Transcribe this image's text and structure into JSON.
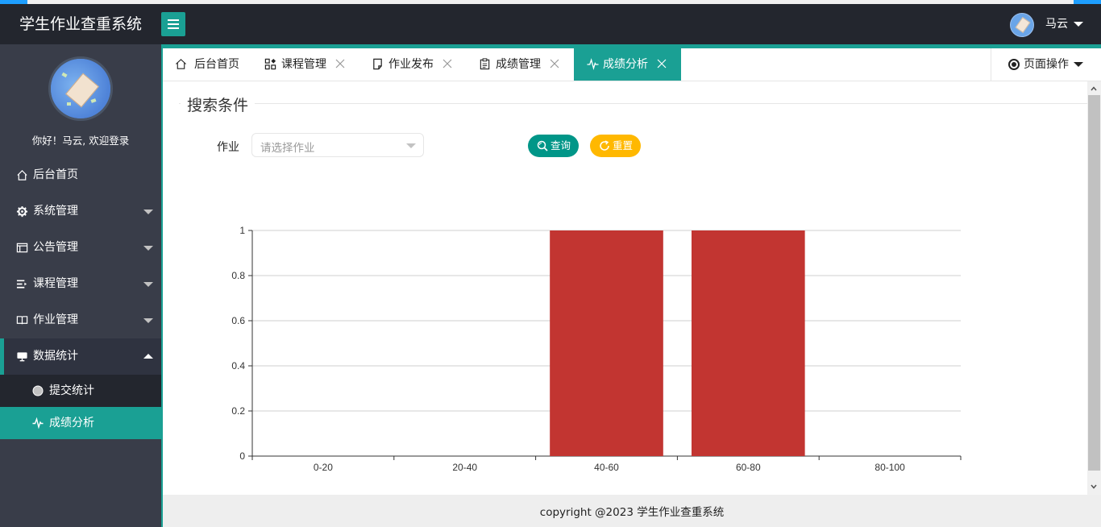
{
  "app": {
    "title": "学生作业查重系统",
    "user_name": "马云",
    "welcome": "你好！马云, 欢迎登录"
  },
  "sidebar": {
    "items": [
      {
        "label": "后台首页",
        "icon": "home-icon"
      },
      {
        "label": "系统管理",
        "icon": "gear-icon"
      },
      {
        "label": "公告管理",
        "icon": "layout-icon"
      },
      {
        "label": "课程管理",
        "icon": "list-icon"
      },
      {
        "label": "作业管理",
        "icon": "book-icon"
      },
      {
        "label": "数据统计",
        "icon": "monitor-icon",
        "expanded": true
      }
    ],
    "sub_items": [
      {
        "label": "提交统计",
        "icon": "circle-icon"
      },
      {
        "label": "成绩分析",
        "icon": "pulse-icon",
        "active": true
      }
    ]
  },
  "tabs": [
    {
      "label": "后台首页",
      "icon": "home-icon",
      "closable": false
    },
    {
      "label": "课程管理",
      "icon": "apps-icon",
      "closable": true
    },
    {
      "label": "作业发布",
      "icon": "note-icon",
      "closable": true
    },
    {
      "label": "成绩管理",
      "icon": "clipboard-icon",
      "closable": true
    },
    {
      "label": "成绩分析",
      "icon": "pulse-icon",
      "closable": true,
      "active": true
    }
  ],
  "page_ops": {
    "label": "页面操作"
  },
  "search": {
    "legend": "搜索条件",
    "field_label": "作业",
    "placeholder": "请选择作业",
    "query_label": "查询",
    "reset_label": "重置"
  },
  "footer": {
    "text": "copyright @2023 学生作业查重系统"
  },
  "colors": {
    "accent": "#1aa094",
    "query": "#009688",
    "reset": "#ffb800",
    "bar": "#c23531",
    "dark": "#23262e",
    "sidebar": "#393d49"
  },
  "chart_data": {
    "type": "bar",
    "categories": [
      "0-20",
      "20-40",
      "40-60",
      "60-80",
      "80-100"
    ],
    "values": [
      0,
      0,
      1,
      1,
      0
    ],
    "ylim": [
      0,
      1
    ],
    "yticks": [
      0,
      0.2,
      0.4,
      0.6,
      0.8,
      1
    ],
    "grid": true
  }
}
